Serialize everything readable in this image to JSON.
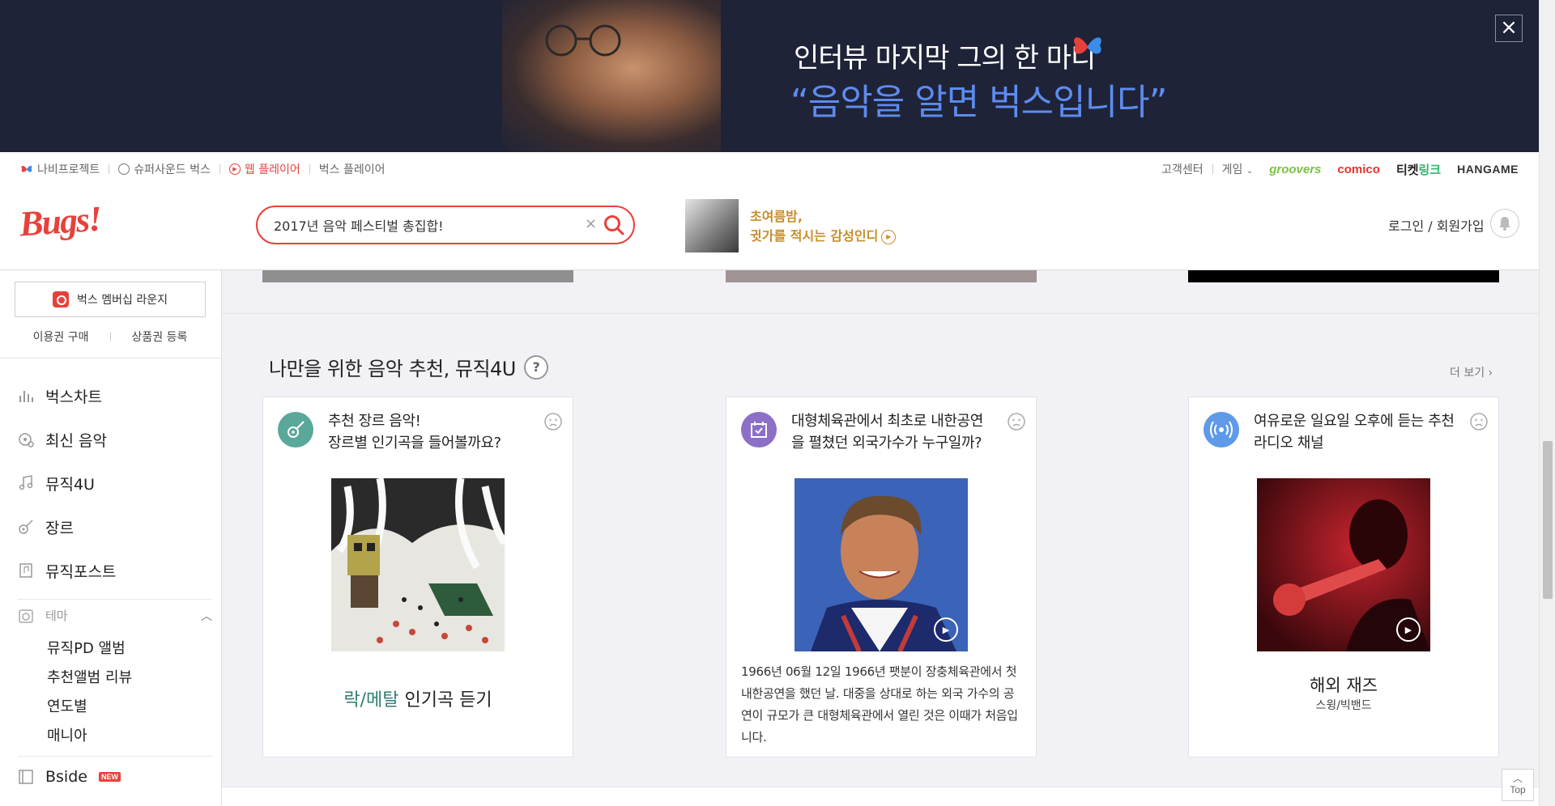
{
  "banner": {
    "line1": "인터뷰 마지막 그의 한 마디",
    "line2": "“음악을 알면 벅스입니다”",
    "close_label": "×"
  },
  "topbar": {
    "links": [
      {
        "label": "나비프로젝트",
        "icon": "butterfly-icon"
      },
      {
        "label": "슈퍼사운드 벅스",
        "icon": "super-sound-icon"
      },
      {
        "label": "웹 플레이어",
        "icon": "play-circle-icon"
      },
      {
        "label": "벅스 플레이어",
        "icon": ""
      }
    ],
    "right_links": [
      "고객센터",
      "게임"
    ],
    "brands": {
      "groovers": "groovers",
      "comico": "comico",
      "ticket_a": "티켓",
      "ticket_b": "링크",
      "hangame": "HANGAME"
    }
  },
  "header": {
    "logo": "Bugs!",
    "search_value": "2017년 음악 페스티벌 총집합!",
    "promo_line1": "초여름밤,",
    "promo_line2": "귓가를 적시는 감성인디",
    "login": "로그인 / 회원가입"
  },
  "sidebar": {
    "membership": "벅스 멤버십 라운지",
    "buy": "이용권 구매",
    "register": "상품권 등록",
    "items": [
      {
        "label": "벅스차트",
        "icon": "chart-bars-icon"
      },
      {
        "label": "최신 음악",
        "icon": "new-music-icon"
      },
      {
        "label": "뮤직4U",
        "icon": "music-note-icon"
      },
      {
        "label": "장르",
        "icon": "guitar-icon"
      },
      {
        "label": "뮤직포스트",
        "icon": "music-post-icon"
      }
    ],
    "theme_label": "테마",
    "theme_items": [
      "뮤직PD 앨범",
      "추천앨범 리뷰",
      "연도별",
      "매니아"
    ],
    "bside": "Bside",
    "new_badge": "NEW"
  },
  "main": {
    "section_title": "나만을 위한 음악 추천, 뮤직4U",
    "help": "?",
    "more": "더 보기 ›",
    "cards": [
      {
        "title_line1": "추천 장르 음악!",
        "title_line2": "장르별 인기곡을 들어볼까요?",
        "genre": "락/메탈",
        "genre_suffix": " 인기곡 듣기",
        "icon": "guitar-icon",
        "icon_color": "#5aa89a"
      },
      {
        "title_line1": "대형체육관에서 최초로 내한공연",
        "title_line2": "을 펼쳤던 외국가수가 누구일까?",
        "desc": "1966년 06월 12일 1966년 팻분이 장충체육관에서 첫 내한공연을 했던 날. 대중을 상대로 하는 외국 가수의 공연이 규모가 큰 대형체육관에서 열린 것은 이때가 처음입니다.",
        "icon": "calendar-check-icon",
        "icon_color": "#8c6fc6"
      },
      {
        "title_line1": "여유로운 일요일 오후에 듣는 추천",
        "title_line2": "라디오 채널",
        "album_title": "해외 재즈",
        "album_sub": "스윙/빅밴드",
        "icon": "radio-waves-icon",
        "icon_color": "#5e9ae8"
      }
    ]
  },
  "top_button": "Top",
  "colors": {
    "accent": "#e8413c",
    "banner_bg": "#1f2337",
    "banner_blue": "#5d8bf0",
    "promo_gold": "#c88d2a"
  }
}
